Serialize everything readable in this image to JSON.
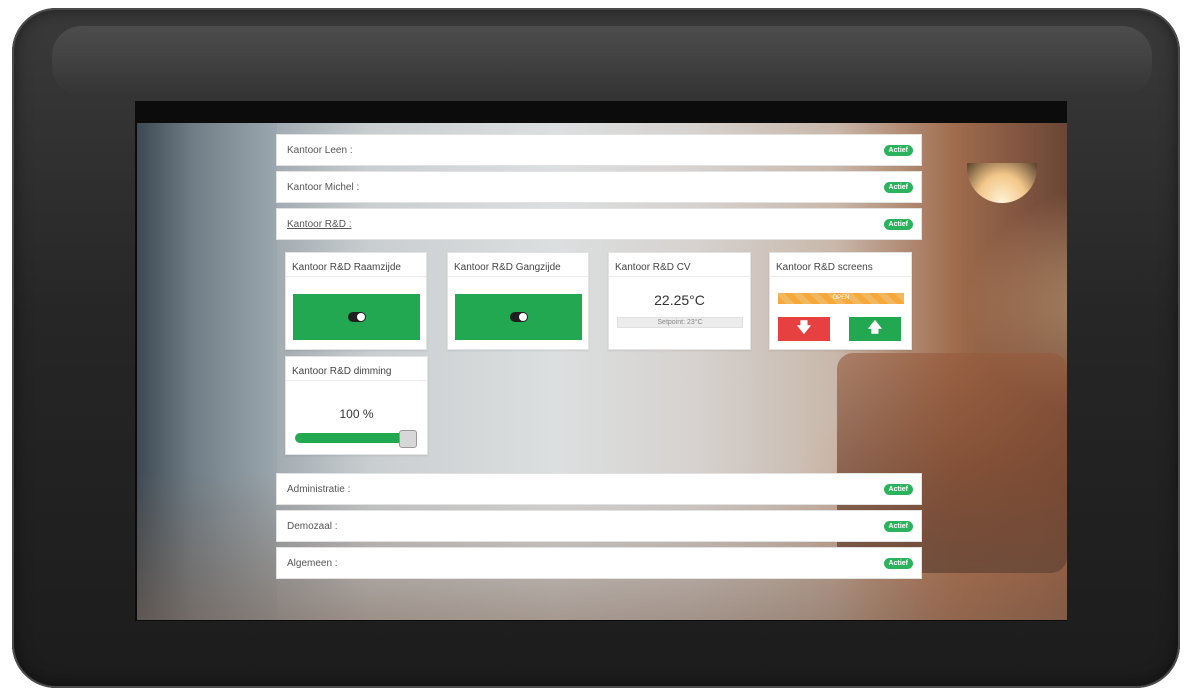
{
  "sections_top": [
    {
      "label": "Kantoor Leen :",
      "badge": "Actief"
    },
    {
      "label": "Kantoor Michel :",
      "badge": "Actief"
    },
    {
      "label": "Kantoor R&D :",
      "badge": "Actief"
    }
  ],
  "cards": {
    "raamzijde": {
      "title": "Kantoor R&D Raamzijde",
      "state": "on"
    },
    "gangzijde": {
      "title": "Kantoor R&D Gangzijde",
      "state": "on"
    },
    "cv": {
      "title": "Kantoor R&D CV",
      "temperature": "22.25°C",
      "setpoint": "Setpoint: 23°C"
    },
    "screens": {
      "title": "Kantoor R&D screens",
      "status": "OPEN",
      "down_icon": "arrow-down-icon",
      "up_icon": "arrow-up-icon"
    },
    "dimming": {
      "title": "Kantoor R&D dimming",
      "value": "100 %",
      "level": 1.0
    }
  },
  "sections_bottom": [
    {
      "label": "Administratie :",
      "badge": "Actief"
    },
    {
      "label": "Demozaal :",
      "badge": "Actief"
    },
    {
      "label": "Algemeen :",
      "badge": "Actief"
    }
  ],
  "colors": {
    "accent_green": "#22a850",
    "badge_green": "#2bb25c",
    "down_red": "#e64040",
    "open_orange": "#f6a93a"
  }
}
